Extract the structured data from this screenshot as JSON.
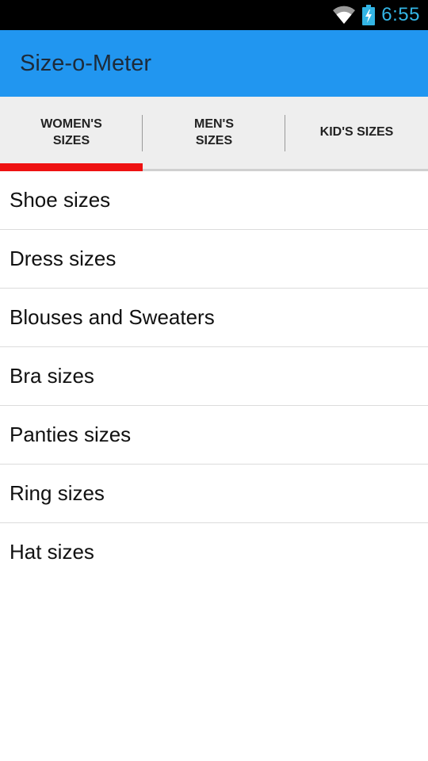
{
  "status_bar": {
    "time": "6:55",
    "icons": [
      "wifi-icon",
      "battery-charging-icon"
    ],
    "time_color": "#33b5e5"
  },
  "action_bar": {
    "title": "Size-o-Meter",
    "background": "#2196f0"
  },
  "tabs": [
    {
      "label": "WOMEN'S SIZES",
      "selected": true
    },
    {
      "label": "MEN'S SIZES",
      "selected": false
    },
    {
      "label": "KID'S SIZES",
      "selected": false
    }
  ],
  "tab_indicator_color": "#ee1111",
  "list": {
    "items": [
      {
        "label": "Shoe sizes"
      },
      {
        "label": "Dress sizes"
      },
      {
        "label": "Blouses and Sweaters"
      },
      {
        "label": "Bra sizes"
      },
      {
        "label": "Panties sizes"
      },
      {
        "label": "Ring sizes"
      },
      {
        "label": "Hat sizes"
      }
    ]
  }
}
